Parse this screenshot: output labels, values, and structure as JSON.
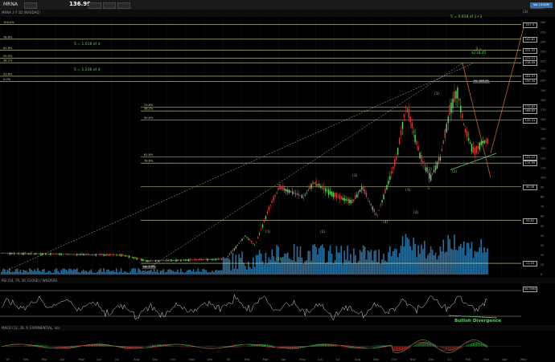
{
  "app": {
    "symbol": "MRNA",
    "price": "136.99"
  },
  "chart_header": {
    "title": "MRNA 3 Y 1D [NASDAQ]"
  },
  "volume_label": "Vol 13.60M",
  "fib_levels": [
    {
      "label": "100.0%",
      "price": "257.9"
    },
    {
      "label": "78.6%",
      "price": "242.82"
    },
    {
      "label": "61.8%",
      "price": "231.37"
    },
    {
      "label": "50.0%",
      "price": "223.13"
    },
    {
      "label": "38.2%",
      "price": "218.45"
    },
    {
      "label": "23.6%",
      "price": "204.57"
    },
    {
      "label": "0.0%",
      "price": "199.34"
    },
    {
      "label": "23.6%",
      "price": "172.67"
    },
    {
      "label": "38.2%",
      "price": "168.82"
    },
    {
      "label": "50.0%",
      "price": "159.41"
    },
    {
      "label": "61.8%",
      "price": "121.12"
    },
    {
      "label": "78.6%",
      "price": "114.99"
    },
    {
      "label": "",
      "price": "90.58"
    },
    {
      "label": "",
      "price": "55.82"
    },
    {
      "label": "",
      "price": "11.54"
    }
  ],
  "annotations": {
    "top_proj": "5 = 0.618 of 1+3",
    "proj_1618": "5 = 1.618 of 4",
    "proj_1236": "5 = 1.236 of 4",
    "peak": "3 =\n$218.45",
    "hi_marker": "Hi: 189.25",
    "lo_marker": "Lo: 2.93",
    "bullish": "Bullish Divergence"
  },
  "waves": [
    "(1)",
    "(2)",
    "(1)",
    "(2)",
    "(3)",
    "(4)",
    "(1)",
    "(2)",
    "i (3)",
    "ii",
    "(1)",
    "(2)",
    "(3)",
    "(4)",
    "iii (5)",
    "iv",
    "v"
  ],
  "rsi": {
    "label": "RSI (14, 70, 30, CLOSE) / WILDERS",
    "value": "44.0564",
    "levels": [
      "70",
      "30"
    ]
  },
  "macd": {
    "label": "MACD (12, 26, 9, EXPONENTIAL, no)",
    "value": "4.3048",
    "hist": "-6.7514"
  },
  "x_axis": [
    "'19",
    "Feb",
    "Mar",
    "Apr",
    "May",
    "Jun",
    "Jul",
    "Aug",
    "Sep",
    "Oct",
    "Nov",
    "Dec",
    "'20",
    "Feb",
    "Mar",
    "Apr",
    "May",
    "Jun",
    "Jul",
    "Aug",
    "Sep",
    "Oct",
    "Nov",
    "Dec",
    "'21",
    "Feb",
    "Mar",
    "Apr",
    "May"
  ],
  "y_ticks": [
    "260",
    "250",
    "240",
    "230",
    "220",
    "210",
    "200",
    "190",
    "180",
    "170",
    "160",
    "150",
    "140",
    "130",
    "120",
    "110",
    "100",
    "90",
    "80",
    "70",
    "60",
    "50",
    "40",
    "30",
    "20",
    "10",
    "0"
  ],
  "colors": {
    "bg": "#000000",
    "fib": "#cfd8a0",
    "green": "#5fd45f",
    "red": "#d23b3b",
    "volume": "#2a6f9e",
    "orange": "#e07030"
  }
}
